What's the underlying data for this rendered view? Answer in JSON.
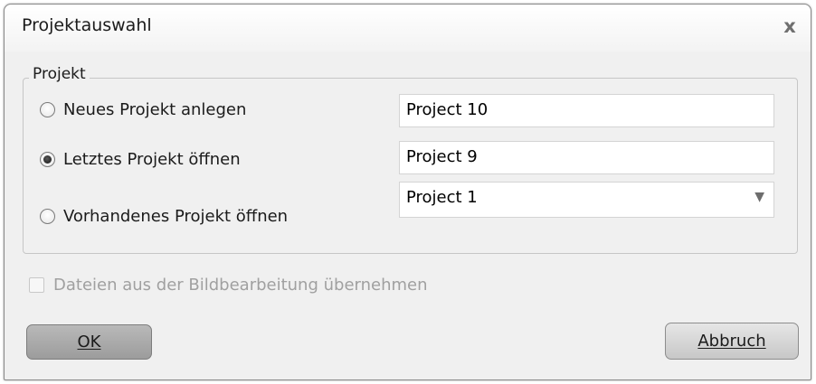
{
  "window": {
    "title": "Projektauswahl",
    "close_glyph": "x"
  },
  "group": {
    "legend": "Projekt",
    "options": [
      {
        "label": "Neues Projekt anlegen",
        "checked": false,
        "field_type": "text",
        "value": "Project 10"
      },
      {
        "label": "Letztes Projekt öffnen",
        "checked": true,
        "field_type": "text",
        "value": "Project 9"
      },
      {
        "label": "Vorhandenes Projekt öffnen",
        "checked": false,
        "field_type": "select",
        "value": "Project 1"
      }
    ],
    "dropdown_arrow_glyph": "▼"
  },
  "checkbox": {
    "label": "Dateien aus der Bildbearbeitung übernehmen",
    "checked": false,
    "enabled": false
  },
  "buttons": {
    "ok_label": "OK",
    "cancel_label": "Abbruch"
  }
}
